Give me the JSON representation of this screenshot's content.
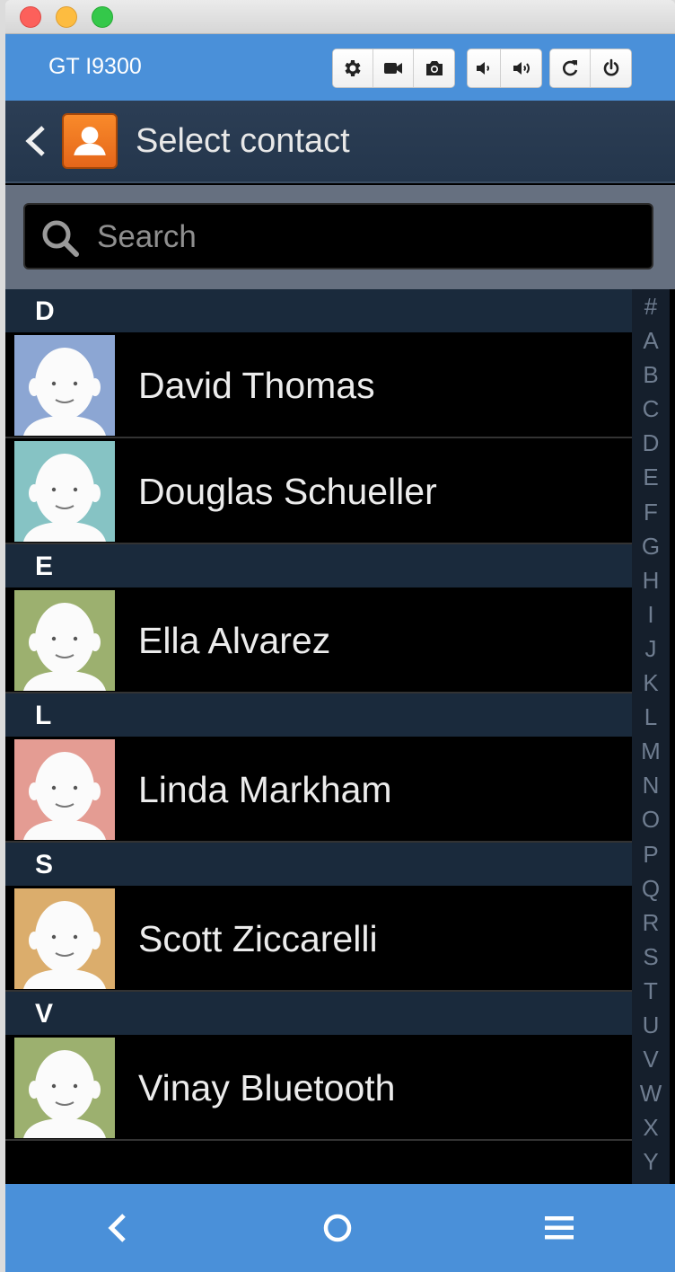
{
  "emulator": {
    "device_name": "GT I9300",
    "toolbar_icons": [
      "settings-icon",
      "video-record-icon",
      "camera-icon",
      "volume-down-icon",
      "volume-up-icon",
      "rotate-icon",
      "power-icon"
    ]
  },
  "action_bar": {
    "title": "Select contact",
    "back_icon": "chevron-left-icon",
    "app_icon": "contacts-app-icon"
  },
  "search": {
    "placeholder": "Search",
    "value": ""
  },
  "sections": [
    {
      "letter": "D",
      "contacts": [
        {
          "name": "David Thomas",
          "avatar_color": "#8ca6d3"
        },
        {
          "name": "Douglas Schueller",
          "avatar_color": "#86c3c4"
        }
      ]
    },
    {
      "letter": "E",
      "contacts": [
        {
          "name": "Ella Alvarez",
          "avatar_color": "#9cb06f"
        }
      ]
    },
    {
      "letter": "L",
      "contacts": [
        {
          "name": "Linda Markham",
          "avatar_color": "#e49c93"
        }
      ]
    },
    {
      "letter": "S",
      "contacts": [
        {
          "name": "Scott Ziccarelli",
          "avatar_color": "#dbad6c"
        }
      ]
    },
    {
      "letter": "V",
      "contacts": [
        {
          "name": "Vinay Bluetooth",
          "avatar_color": "#9cb06f"
        }
      ]
    }
  ],
  "index_letters": [
    "#",
    "A",
    "B",
    "C",
    "D",
    "E",
    "F",
    "G",
    "H",
    "I",
    "J",
    "K",
    "L",
    "M",
    "N",
    "O",
    "P",
    "Q",
    "R",
    "S",
    "T",
    "U",
    "V",
    "W",
    "X",
    "Y"
  ],
  "nav_bar": {
    "icons": [
      "back-icon",
      "home-icon",
      "menu-icon"
    ]
  },
  "colors": {
    "emulator_accent": "#4a90d9",
    "action_bar": "#2c3e55",
    "section_header": "#1a2a3c"
  }
}
